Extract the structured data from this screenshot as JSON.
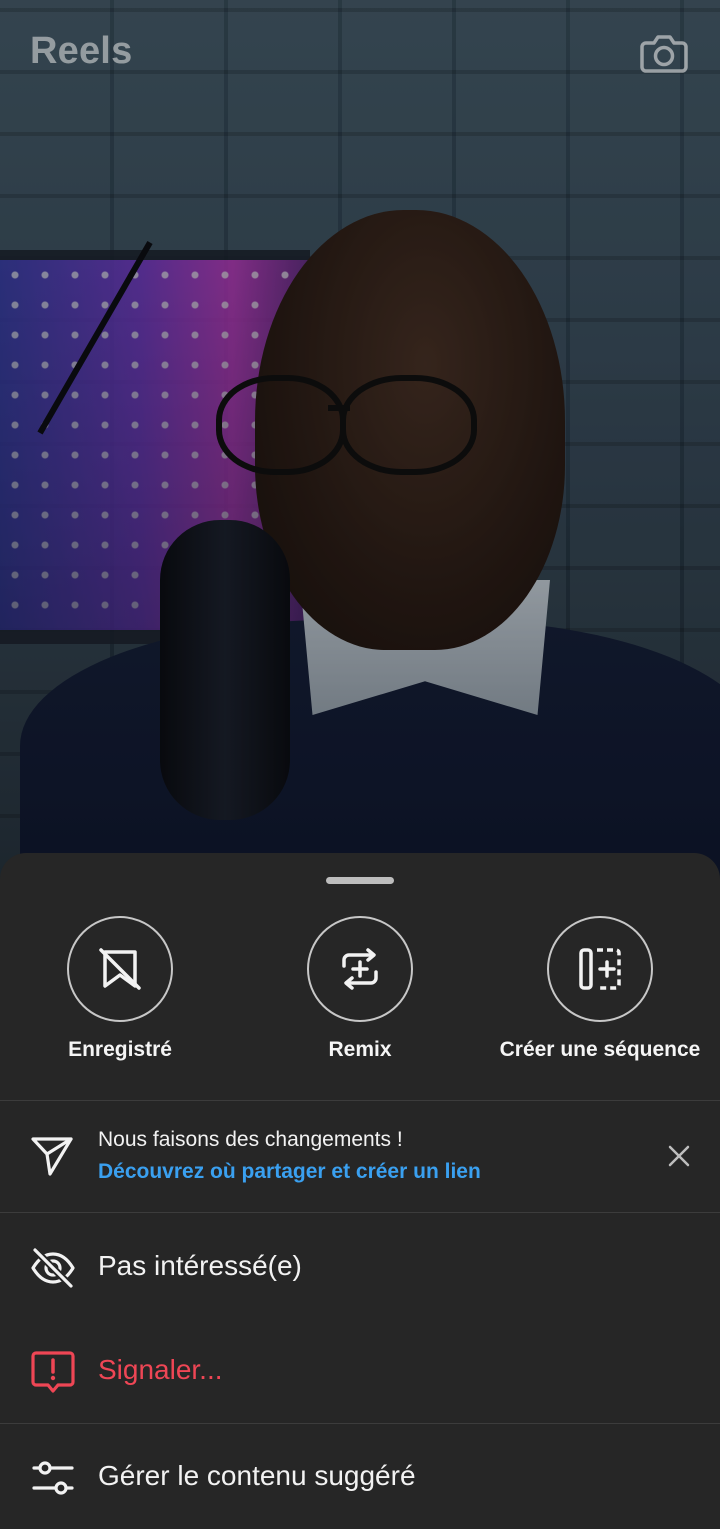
{
  "header": {
    "title": "Reels",
    "camera_icon": "camera-icon"
  },
  "sheet": {
    "actions": [
      {
        "label": "Enregistré",
        "icon": "bookmark-removed-icon"
      },
      {
        "label": "Remix",
        "icon": "remix-icon"
      },
      {
        "label": "Créer une séquence",
        "icon": "sequence-add-icon"
      }
    ],
    "notice": {
      "title": "Nous faisons des changements !",
      "link": "Découvrez où partager et créer un lien",
      "icon": "send-icon",
      "close_icon": "close-icon"
    },
    "menu": [
      {
        "label": "Pas intéressé(e)",
        "icon": "eye-off-icon"
      },
      {
        "label": "Signaler...",
        "icon": "report-icon"
      },
      {
        "label": "Gérer le contenu suggéré",
        "icon": "sliders-icon"
      }
    ]
  },
  "colors": {
    "sheet_bg": "#262626",
    "link": "#3aa0f0",
    "danger": "#ef4655"
  }
}
